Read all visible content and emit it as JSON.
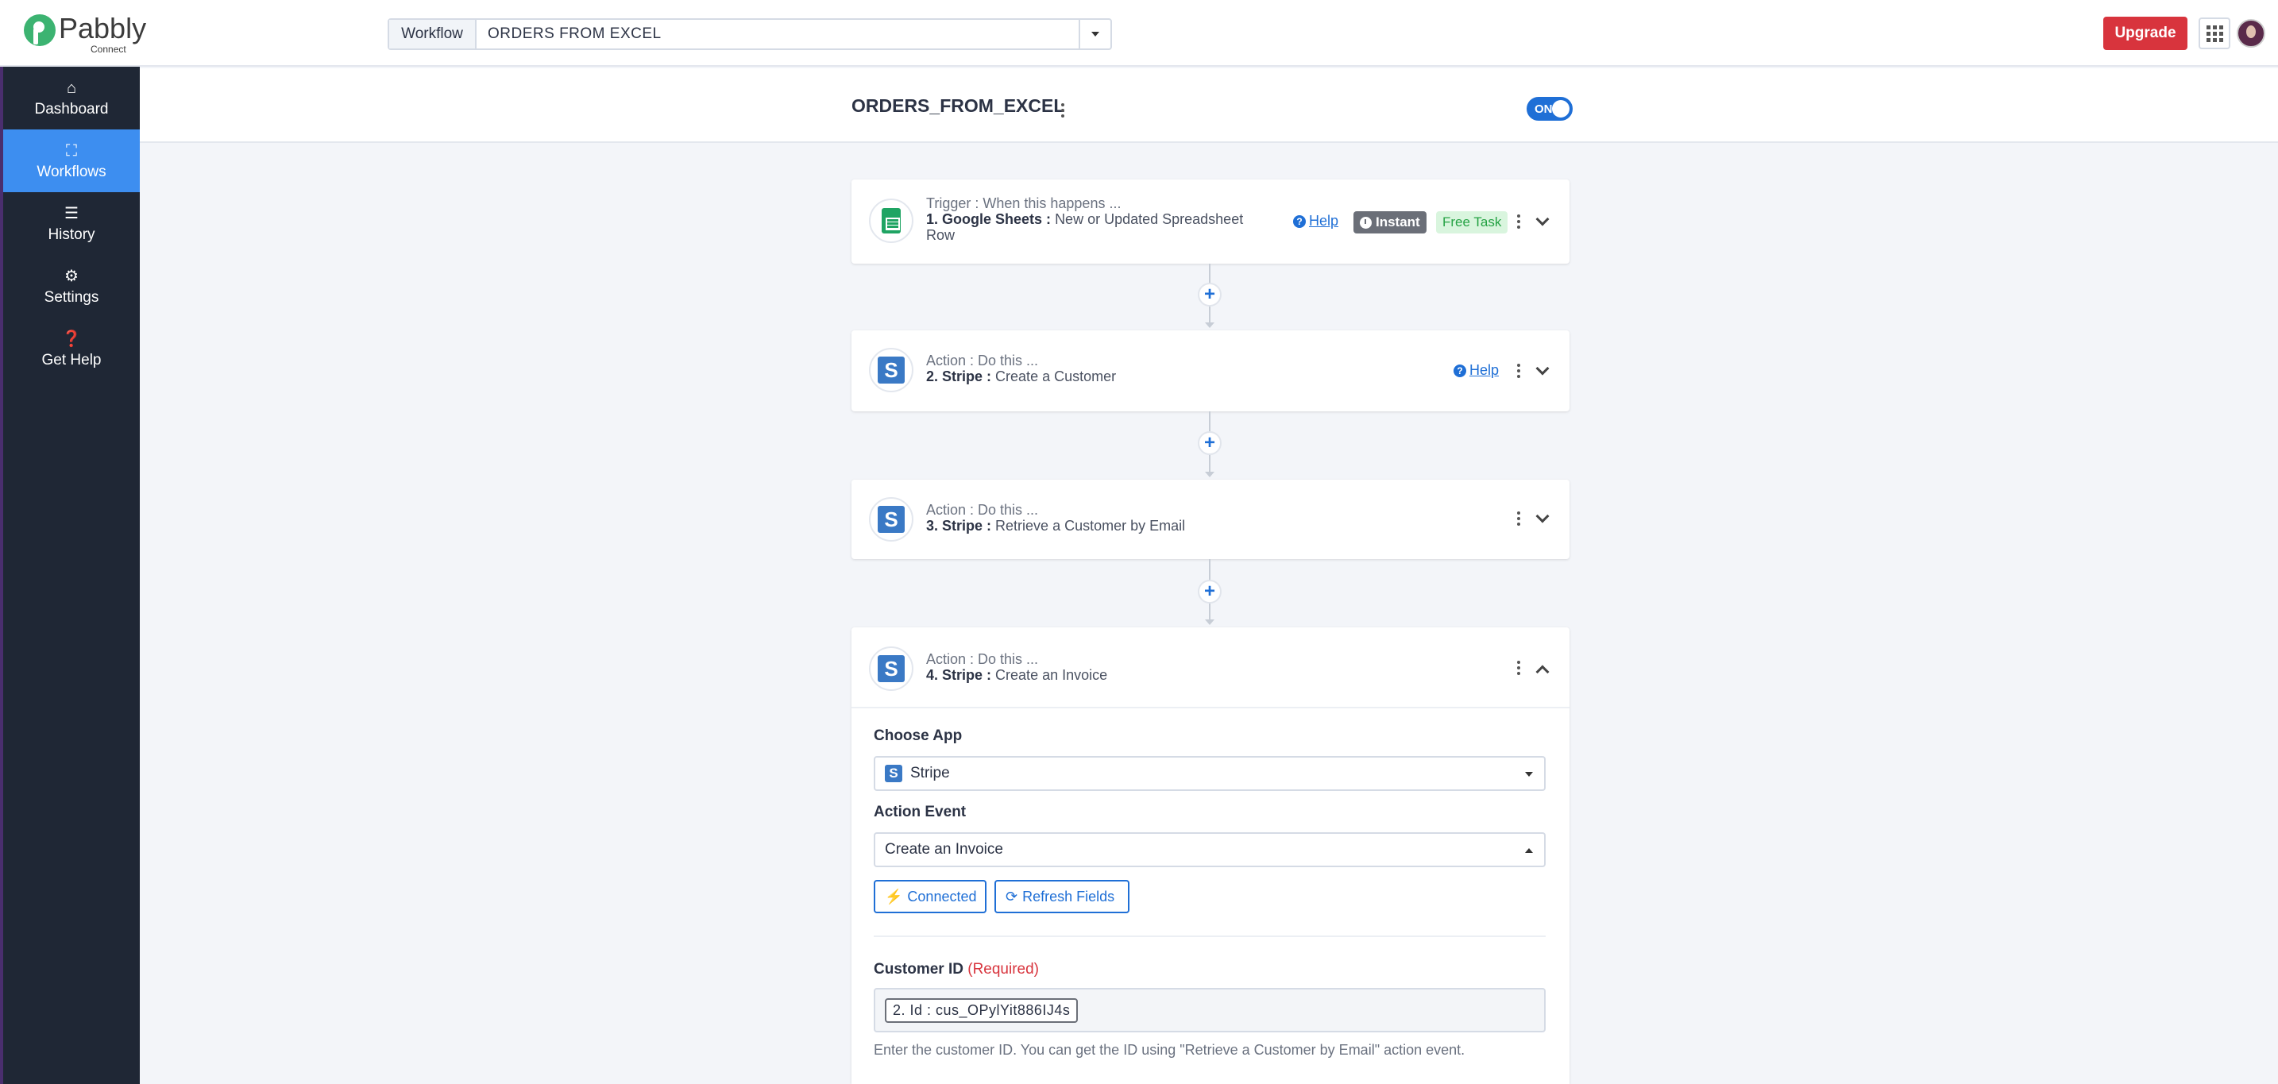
{
  "brand": {
    "name": "Pabbly",
    "sub": "Connect"
  },
  "topbar": {
    "workflow_label": "Workflow",
    "workflow_value": "ORDERS  FROM  EXCEL",
    "upgrade_label": "Upgrade"
  },
  "sidebar": {
    "items": [
      {
        "label": "Dashboard",
        "icon": "home-icon"
      },
      {
        "label": "Workflows",
        "icon": "workflow-icon",
        "active": true
      },
      {
        "label": "History",
        "icon": "list-icon"
      },
      {
        "label": "Settings",
        "icon": "gear-icon"
      },
      {
        "label": "Get Help",
        "icon": "question-icon"
      }
    ]
  },
  "workflow": {
    "title": "ORDERS_FROM_EXCEL",
    "toggle_label": "ON"
  },
  "steps": [
    {
      "kind": "Trigger : When this happens ...",
      "number_app": "1. Google Sheets :",
      "event": "New or Updated Spreadsheet Row",
      "help": "Help",
      "instant": "Instant",
      "free": "Free Task"
    },
    {
      "kind": "Action : Do this ...",
      "number_app": "2. Stripe :",
      "event": "Create a Customer",
      "help": "Help"
    },
    {
      "kind": "Action : Do this ...",
      "number_app": "3. Stripe :",
      "event": "Retrieve a Customer by Email"
    },
    {
      "kind": "Action : Do this ...",
      "number_app": "4. Stripe :",
      "event": "Create an Invoice"
    }
  ],
  "plus_symbol": "+",
  "editor": {
    "choose_app_label": "Choose App",
    "choose_app_value": "Stripe",
    "stripe_letter": "S",
    "action_event_label": "Action Event",
    "action_event_value": "Create an Invoice",
    "connected_label": "Connected",
    "refresh_label": "Refresh Fields",
    "customer_id_label": "Customer ID",
    "required_label": "(Required)",
    "customer_id_token": "2. Id : cus_OPylYit886IJ4s",
    "customer_id_hint": "Enter the customer ID. You can get the ID using \"Retrieve a Customer by Email\" action event."
  },
  "colors": {
    "sidebar_bg": "#1f2735",
    "active_blue": "#3d8ef0",
    "upgrade_red": "#d8343d",
    "link_blue": "#1f6fd6",
    "free_green": "#25a244"
  }
}
